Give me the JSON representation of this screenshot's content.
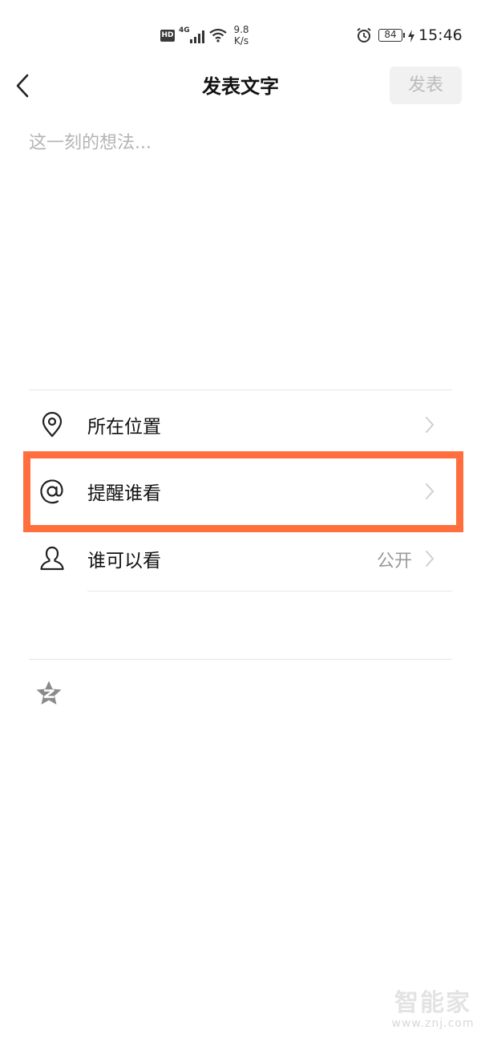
{
  "status_bar": {
    "hd": "HD",
    "network": "4G",
    "speed_value": "9.8",
    "speed_unit": "K/s",
    "battery": "84",
    "time": "15:46"
  },
  "nav": {
    "title": "发表文字",
    "publish_label": "发表"
  },
  "composer": {
    "placeholder": "这一刻的想法..."
  },
  "options": [
    {
      "label": "所在位置",
      "value": "",
      "icon": "location-pin-icon"
    },
    {
      "label": "提醒谁看",
      "value": "",
      "icon": "at-icon"
    },
    {
      "label": "谁可以看",
      "value": "公开",
      "icon": "person-icon"
    }
  ],
  "watermark": {
    "logo": "智能家",
    "url": "www.znj.com"
  },
  "colors": {
    "highlight": "#ff6e3c",
    "placeholder": "#b4b4b4",
    "publish_disabled_bg": "#f1f1f1",
    "publish_disabled_text": "#bcbcbc"
  }
}
